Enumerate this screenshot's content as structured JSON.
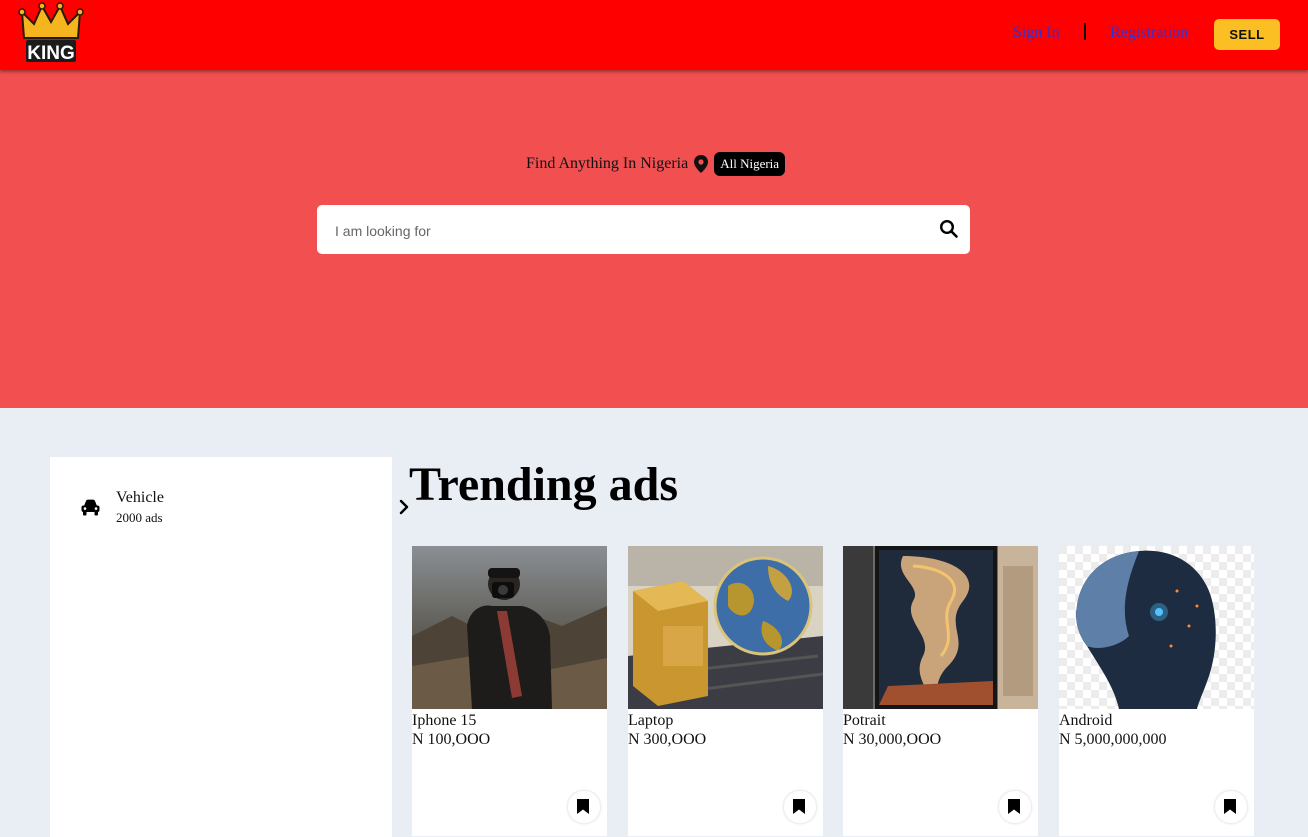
{
  "header": {
    "logo_text": "KING",
    "signin_label": "Sign In",
    "register_label": "Registration",
    "sell_label": "SELL",
    "brand_color": "#ff0000",
    "sell_color": "#fbbf24"
  },
  "hero": {
    "tagline": "Find Anything In Nigeria",
    "location_label": "All Nigeria",
    "search_placeholder": "I am looking for",
    "background_color": "#f24f50"
  },
  "sidebar": {
    "categories": [
      {
        "name": "Vehicle",
        "count": "2000 ads",
        "icon": "car-icon"
      }
    ]
  },
  "trending": {
    "title": "Trending ads",
    "items": [
      {
        "title": "Iphone 15",
        "price": "N 100,OOO"
      },
      {
        "title": "Laptop",
        "price": "N 300,OOO"
      },
      {
        "title": "Potrait",
        "price": "N 30,000,OOO"
      },
      {
        "title": "Android",
        "price": "N 5,000,000,000"
      }
    ]
  }
}
